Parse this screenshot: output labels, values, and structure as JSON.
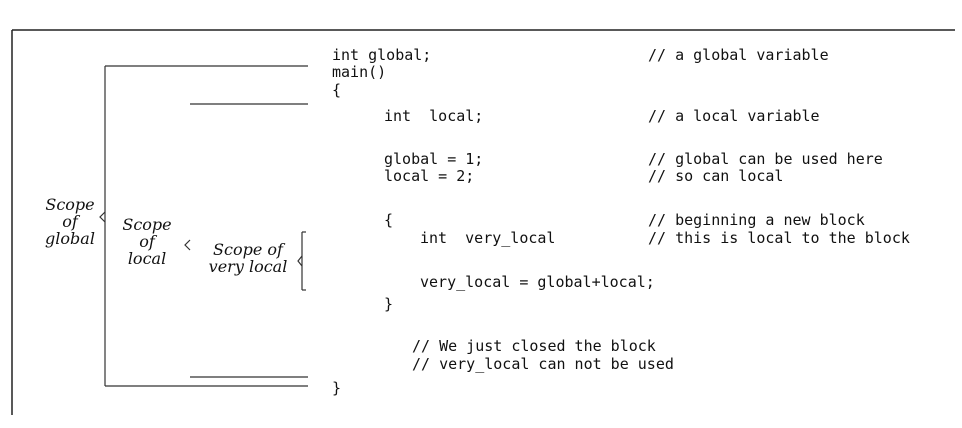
{
  "code_lines": [
    {
      "code": "int global;",
      "comment": "// a global variable"
    },
    {
      "code": "main()",
      "comment": ""
    },
    {
      "code": "{",
      "comment": ""
    },
    {
      "code": "int  local;",
      "comment": "// a local variable"
    },
    {
      "code": "global = 1;",
      "comment": "// global can be used here"
    },
    {
      "code": "local = 2;",
      "comment": "// so can local"
    },
    {
      "code": "{",
      "comment": "// beginning a new block"
    },
    {
      "code": "int  very_local",
      "comment": "// this is local to the block"
    },
    {
      "code": "very_local = global+local;",
      "comment": ""
    },
    {
      "code": "}",
      "comment": ""
    },
    {
      "code": "// We just closed the block",
      "comment": ""
    },
    {
      "code": "// very_local can not be used",
      "comment": ""
    },
    {
      "code": "}",
      "comment": ""
    }
  ],
  "scopes": {
    "global": {
      "line1": "Scope",
      "line2": "of",
      "line3": "global"
    },
    "local": {
      "line1": "Scope",
      "line2": "of",
      "line3": "local"
    },
    "very_local": {
      "line1": "Scope of",
      "line2": "very local"
    }
  }
}
